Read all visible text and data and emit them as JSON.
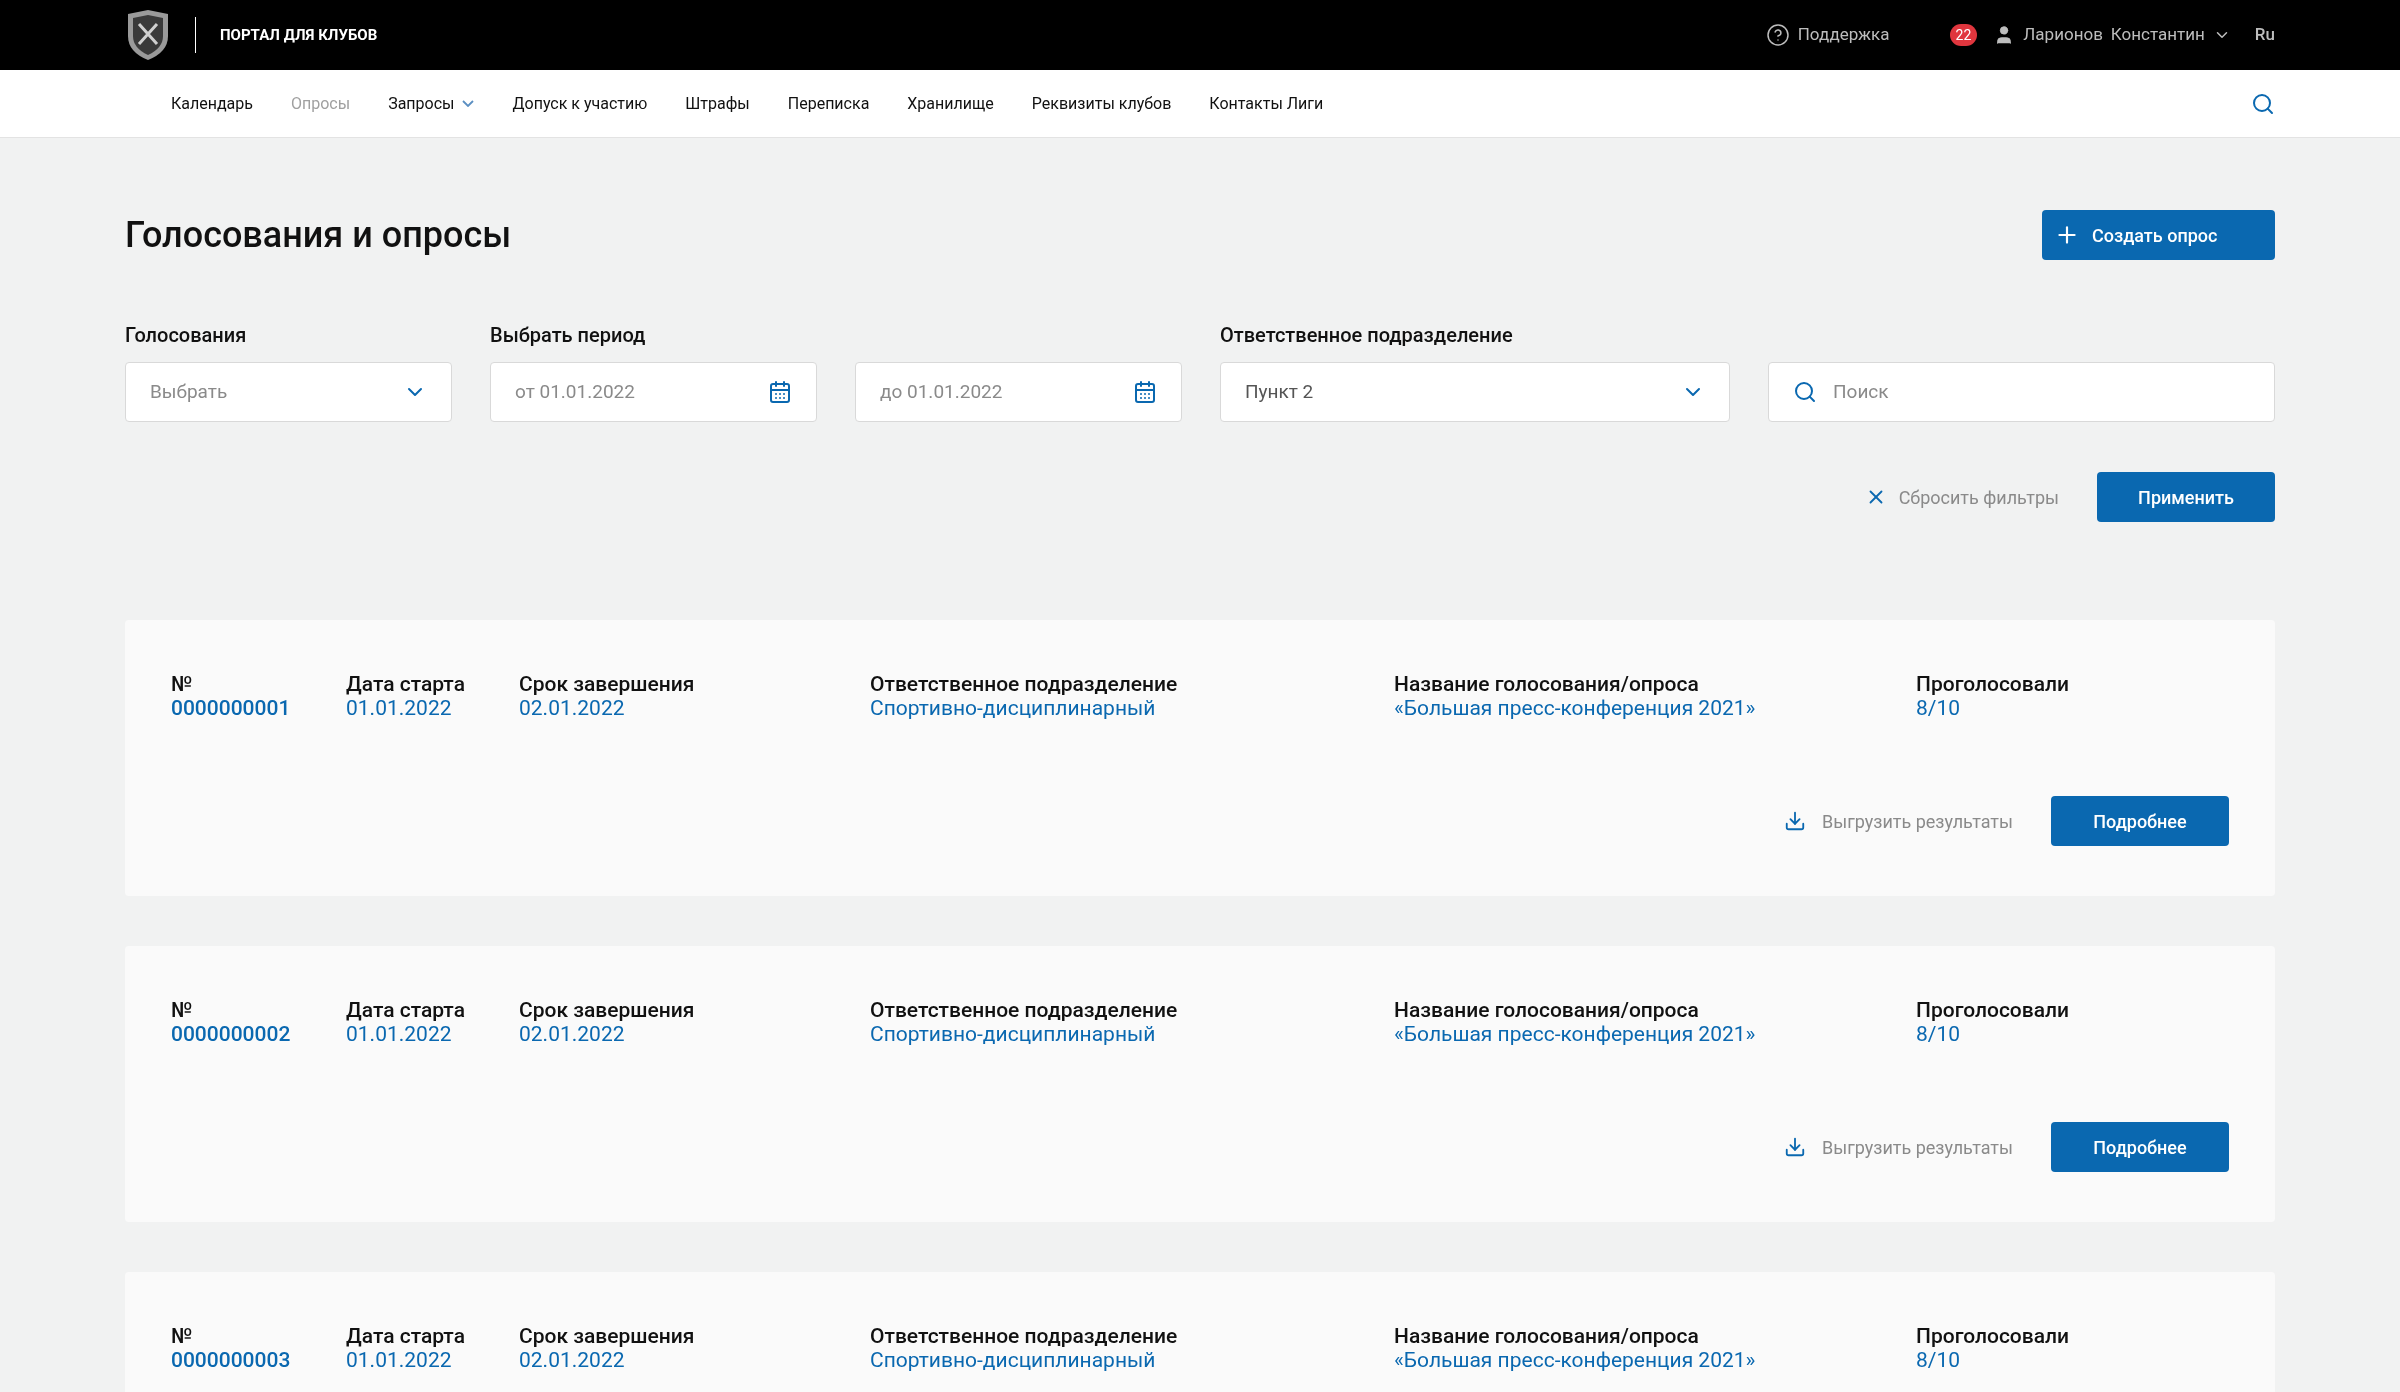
{
  "header": {
    "portal_title": "ПОРТАЛ ДЛЯ КЛУБОВ",
    "support": "Поддержка",
    "notifications": "22",
    "user_first": "Ларионов",
    "user_last": "Константин",
    "language": "Ru"
  },
  "nav": [
    {
      "label": "Календарь",
      "selected": false,
      "has_menu": false
    },
    {
      "label": "Опросы",
      "selected": true,
      "has_menu": false
    },
    {
      "label": "Запросы",
      "selected": false,
      "has_menu": true
    },
    {
      "label": "Допуск к участию",
      "selected": false,
      "has_menu": false
    },
    {
      "label": "Штрафы",
      "selected": false,
      "has_menu": false
    },
    {
      "label": "Переписка",
      "selected": false,
      "has_menu": false
    },
    {
      "label": "Хранилище",
      "selected": false,
      "has_menu": false
    },
    {
      "label": "Реквизиты клубов",
      "selected": false,
      "has_menu": false
    },
    {
      "label": "Контакты Лиги",
      "selected": false,
      "has_menu": false
    }
  ],
  "page": {
    "title": "Голосования и опросы",
    "create_button": "Создать опрос"
  },
  "filters": {
    "votes_label": "Голосования",
    "votes_placeholder": "Выбрать",
    "period_label": "Выбрать период",
    "from_placeholder": "от 01.01.2022",
    "to_placeholder": "до 01.01.2022",
    "dept_label": "Ответственное подразделение",
    "dept_value": "Пункт 2",
    "search_placeholder": "Поиск",
    "reset": "Сбросить фильтры",
    "apply": "Применить"
  },
  "polls": [
    {
      "fields": [
        {
          "label": "№",
          "value": "0000000001"
        },
        {
          "label": "Дата старта",
          "value": "01.01.2022"
        },
        {
          "label": "Срок завершения",
          "value": "02.01.2022"
        },
        {
          "label": "Ответственное подразделение",
          "value": "Спортивно-дисциплинарный"
        },
        {
          "label": "Название голосования/опроса",
          "value": "«Большая пресс-конференция 2021»"
        },
        {
          "label": "Проголосовали",
          "value": "8/10"
        }
      ],
      "export": "Выгрузить результаты",
      "details": "Подробнее"
    },
    {
      "fields": [
        {
          "label": "№",
          "value": "0000000002"
        },
        {
          "label": "Дата старта",
          "value": "01.01.2022"
        },
        {
          "label": "Срок завершения",
          "value": "02.01.2022"
        },
        {
          "label": "Ответственное подразделение",
          "value": "Спортивно-дисциплинарный"
        },
        {
          "label": "Название голосования/опроса",
          "value": "«Большая пресс-конференция 2021»"
        },
        {
          "label": "Проголосовали",
          "value": "8/10"
        }
      ],
      "export": "Выгрузить результаты",
      "details": "Подробнее"
    },
    {
      "fields": [
        {
          "label": "№",
          "value": "0000000003"
        },
        {
          "label": "Дата старта",
          "value": "01.01.2022"
        },
        {
          "label": "Срок завершения",
          "value": "02.01.2022"
        },
        {
          "label": "Ответственное подразделение",
          "value": "Спортивно-дисциплинарный"
        },
        {
          "label": "Название голосования/опроса",
          "value": "«Большая пресс-конференция 2021»"
        },
        {
          "label": "Проголосовали",
          "value": "8/10"
        }
      ]
    }
  ]
}
